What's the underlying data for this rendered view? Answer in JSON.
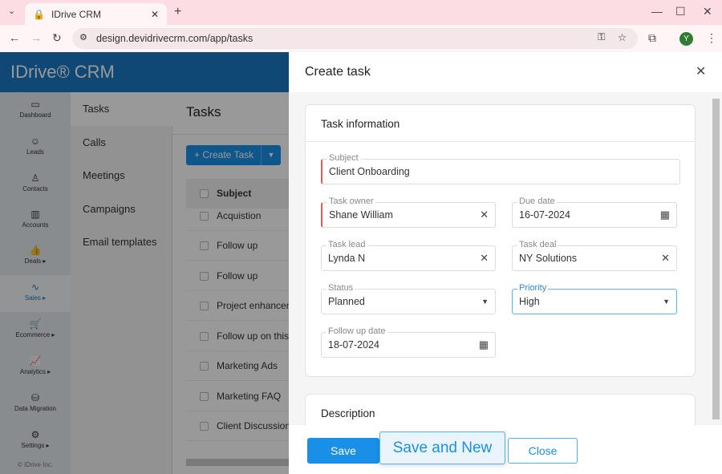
{
  "browser": {
    "tab_title": "IDrive CRM",
    "url": "design.devidrivecrm.com/app/tasks",
    "profile_initial": "Y"
  },
  "app": {
    "logo": "IDrive® CRM",
    "icon_nav": [
      {
        "label": "Dashboard",
        "icon": "▭"
      },
      {
        "label": "Leads",
        "icon": "☺"
      },
      {
        "label": "Contacts",
        "icon": "♙"
      },
      {
        "label": "Accounts",
        "icon": "▥"
      },
      {
        "label": "Deals ▸",
        "icon": "👍"
      },
      {
        "label": "Sales ▸",
        "icon": "∿"
      },
      {
        "label": "Ecommerce ▸",
        "icon": "🛒"
      },
      {
        "label": "Analytics ▸",
        "icon": "📈"
      },
      {
        "label": "Data Migration",
        "icon": "⛁"
      },
      {
        "label": "Settings ▸",
        "icon": "⚙"
      }
    ],
    "copyright": "© IDrive Inc.",
    "sub_nav": [
      "Tasks",
      "Calls",
      "Meetings",
      "Campaigns",
      "Email templates"
    ],
    "page_title": "Tasks",
    "create_button": "+ Create Task",
    "column_subject": "Subject",
    "rows": [
      "Acquistion",
      "Follow up",
      "Follow up",
      "Project enhancement",
      "Follow up on this lead",
      "Marketing Ads",
      "Marketing FAQ",
      "Client Discussion"
    ]
  },
  "panel": {
    "title": "Create task",
    "section_title": "Task information",
    "description_title": "Description",
    "fields": {
      "subject": {
        "label": "Subject",
        "value": "Client Onboarding"
      },
      "owner": {
        "label": "Task owner",
        "value": "Shane William"
      },
      "due": {
        "label": "Due date",
        "value": "16-07-2024"
      },
      "lead": {
        "label": "Task lead",
        "value": "Lynda N"
      },
      "deal": {
        "label": "Task deal",
        "value": "NY Solutions"
      },
      "status": {
        "label": "Status",
        "value": "Planned"
      },
      "priority": {
        "label": "Priority",
        "value": "High"
      },
      "followup": {
        "label": "Follow up date",
        "value": "18-07-2024"
      }
    },
    "buttons": {
      "save": "Save",
      "save_new": "Save and New",
      "close": "Close"
    }
  },
  "colors": {
    "primary": "#1a8fe8",
    "header": "#1a78c2",
    "required": "#e05a4f"
  }
}
